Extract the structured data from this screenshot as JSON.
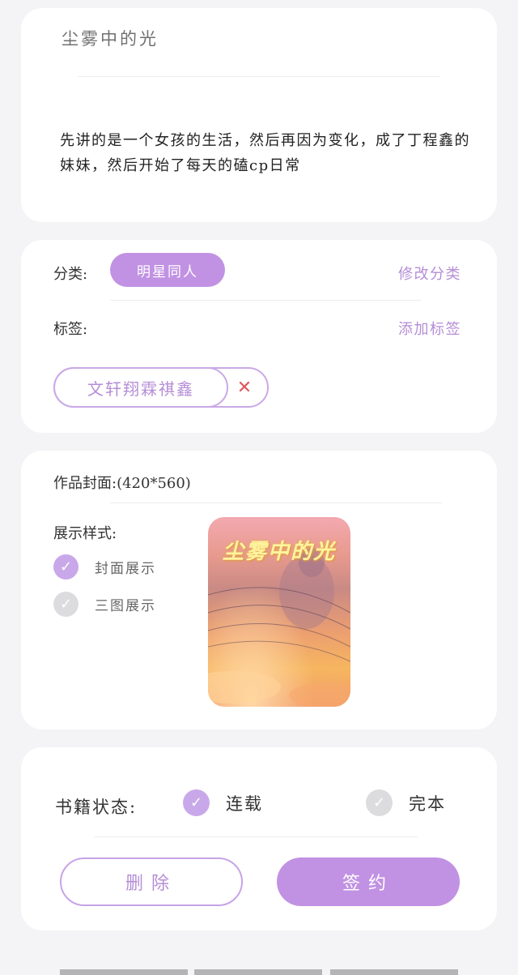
{
  "book": {
    "title": "尘雾中的光",
    "summary": "先讲的是一个女孩的生活，然后再因为变化，成了丁程鑫的妹妹，然后开始了每天的磕cp日常"
  },
  "category": {
    "label": "分类:",
    "value": "明星同人",
    "edit_link": "修改分类"
  },
  "tags": {
    "label": "标签:",
    "add_link": "添加标签",
    "items": [
      {
        "text": "文轩翔霖祺鑫",
        "remove_icon": "close-icon"
      }
    ]
  },
  "cover": {
    "label": "作品封面:(420*560)",
    "display_label": "展示样式:",
    "options": [
      {
        "text": "封面展示",
        "checked": true
      },
      {
        "text": "三图展示",
        "checked": false
      }
    ],
    "image_text": "尘雾中的光"
  },
  "status": {
    "label": "书籍状态:",
    "options": [
      {
        "text": "连载",
        "checked": true
      },
      {
        "text": "完本",
        "checked": false
      }
    ]
  },
  "actions": {
    "delete_label": "删除",
    "sign_label": "签约"
  },
  "colors": {
    "accent": "#c192e3",
    "accent_text": "#b58dd6",
    "danger": "#e2555e",
    "check_off": "#dcdcdf"
  }
}
